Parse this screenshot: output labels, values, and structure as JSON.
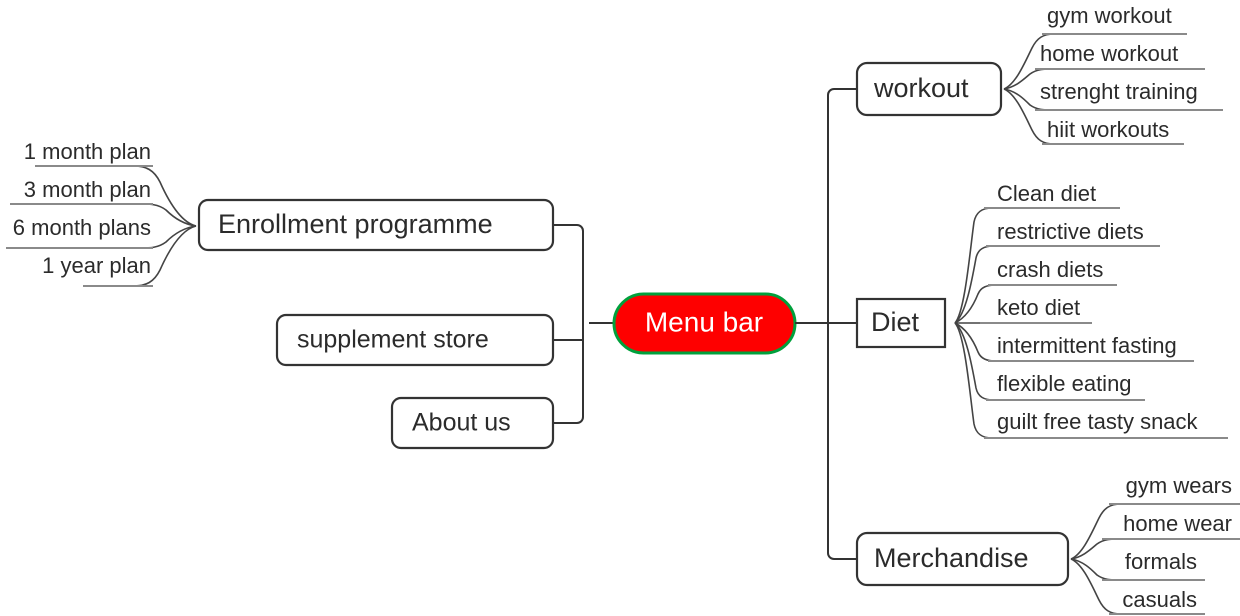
{
  "diagram": {
    "type": "mind-map",
    "title": "Menu bar",
    "colors": {
      "root_fill": "#fe0000",
      "root_border": "#00a03c",
      "root_text": "#ffffff",
      "box_border": "#333333",
      "box_fill": "#ffffff",
      "text": "#2b2b2b",
      "leaf_underline": "#8a8a8a",
      "background": "#ffffff"
    },
    "root": {
      "label": "Menu bar",
      "shape": "rounded-pill"
    },
    "left_branches": [
      {
        "label": "Enrollment programme",
        "shape": "rounded-rect",
        "leaves": [
          {
            "label": "1 month plan"
          },
          {
            "label": "3 month plan"
          },
          {
            "label": "6 month plans"
          },
          {
            "label": "1 year plan"
          }
        ]
      },
      {
        "label": "supplement store",
        "shape": "rounded-rect",
        "leaves": []
      },
      {
        "label": "About us",
        "shape": "rounded-rect",
        "leaves": []
      }
    ],
    "right_branches": [
      {
        "label": "workout",
        "shape": "rounded-rect",
        "leaves": [
          {
            "label": "gym workout"
          },
          {
            "label": "home workout"
          },
          {
            "label": "strenght training"
          },
          {
            "label": "hiit workouts"
          }
        ]
      },
      {
        "label": "Diet",
        "shape": "rect",
        "leaves": [
          {
            "label": "Clean diet"
          },
          {
            "label": "restrictive diets"
          },
          {
            "label": "crash diets"
          },
          {
            "label": "keto diet"
          },
          {
            "label": "intermittent fasting"
          },
          {
            "label": "flexible eating"
          },
          {
            "label": "guilt free tasty snack"
          }
        ]
      },
      {
        "label": "Merchandise",
        "shape": "rounded-rect",
        "leaves": [
          {
            "label": "gym wears"
          },
          {
            "label": "home wear"
          },
          {
            "label": "formals"
          },
          {
            "label": "casuals"
          }
        ]
      }
    ]
  }
}
